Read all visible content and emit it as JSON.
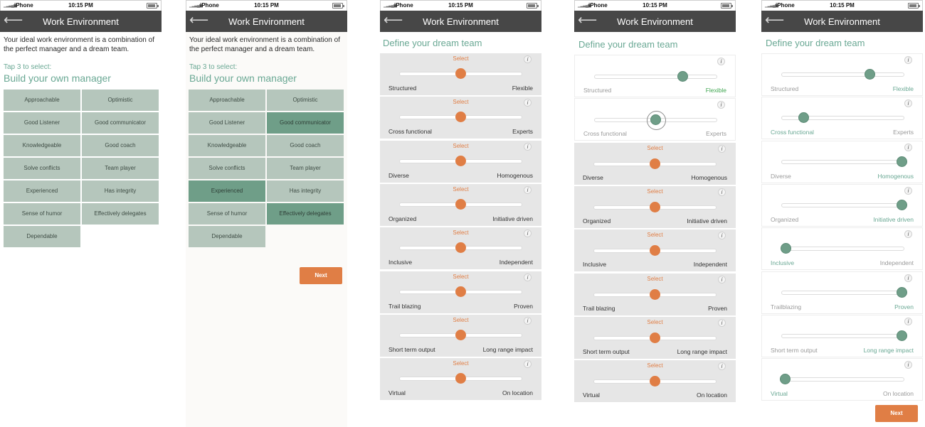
{
  "status": {
    "carrier": "iPhone",
    "time": "10:15 PM"
  },
  "nav": {
    "title": "Work Environment",
    "back_icon": "arrow-left-icon"
  },
  "manager": {
    "intro": "Your ideal work environment is a combination of the perfect manager and a dream team.",
    "tap": "Tap 3 to select:",
    "heading": "Build your own manager",
    "tiles": [
      "Approachable",
      "Optimistic",
      "Good Listener",
      "Good communicator",
      "Knowledgeable",
      "Good coach",
      "Solve conflicts",
      "Team player",
      "Experienced",
      "Has integrity",
      "Sense of humor",
      "Effectively delegates",
      "Dependable"
    ]
  },
  "team": {
    "heading": "Define your dream team",
    "select_label": "Select",
    "info_icon": "info-icon",
    "sliders": [
      {
        "left": "Structured",
        "right": "Flexible"
      },
      {
        "left": "Cross functional",
        "right": "Experts"
      },
      {
        "left": "Diverse",
        "right": "Homogenous"
      },
      {
        "left": "Organized",
        "right": "Initiative driven"
      },
      {
        "left": "Inclusive",
        "right": "Independent"
      },
      {
        "left": "Trail blazing",
        "right": "Proven"
      },
      {
        "left": "Short term output",
        "right": "Long range impact"
      },
      {
        "left": "Virtual",
        "right": "On location"
      }
    ]
  },
  "screen5_labels": {
    "trail": "Trailblazing"
  },
  "next_label": "Next",
  "colors": {
    "accent": "#e07e45",
    "green": "#6aa894",
    "tile": "#b5c6bc",
    "tile_selected": "#6f9e88",
    "navbar": "#474747"
  }
}
